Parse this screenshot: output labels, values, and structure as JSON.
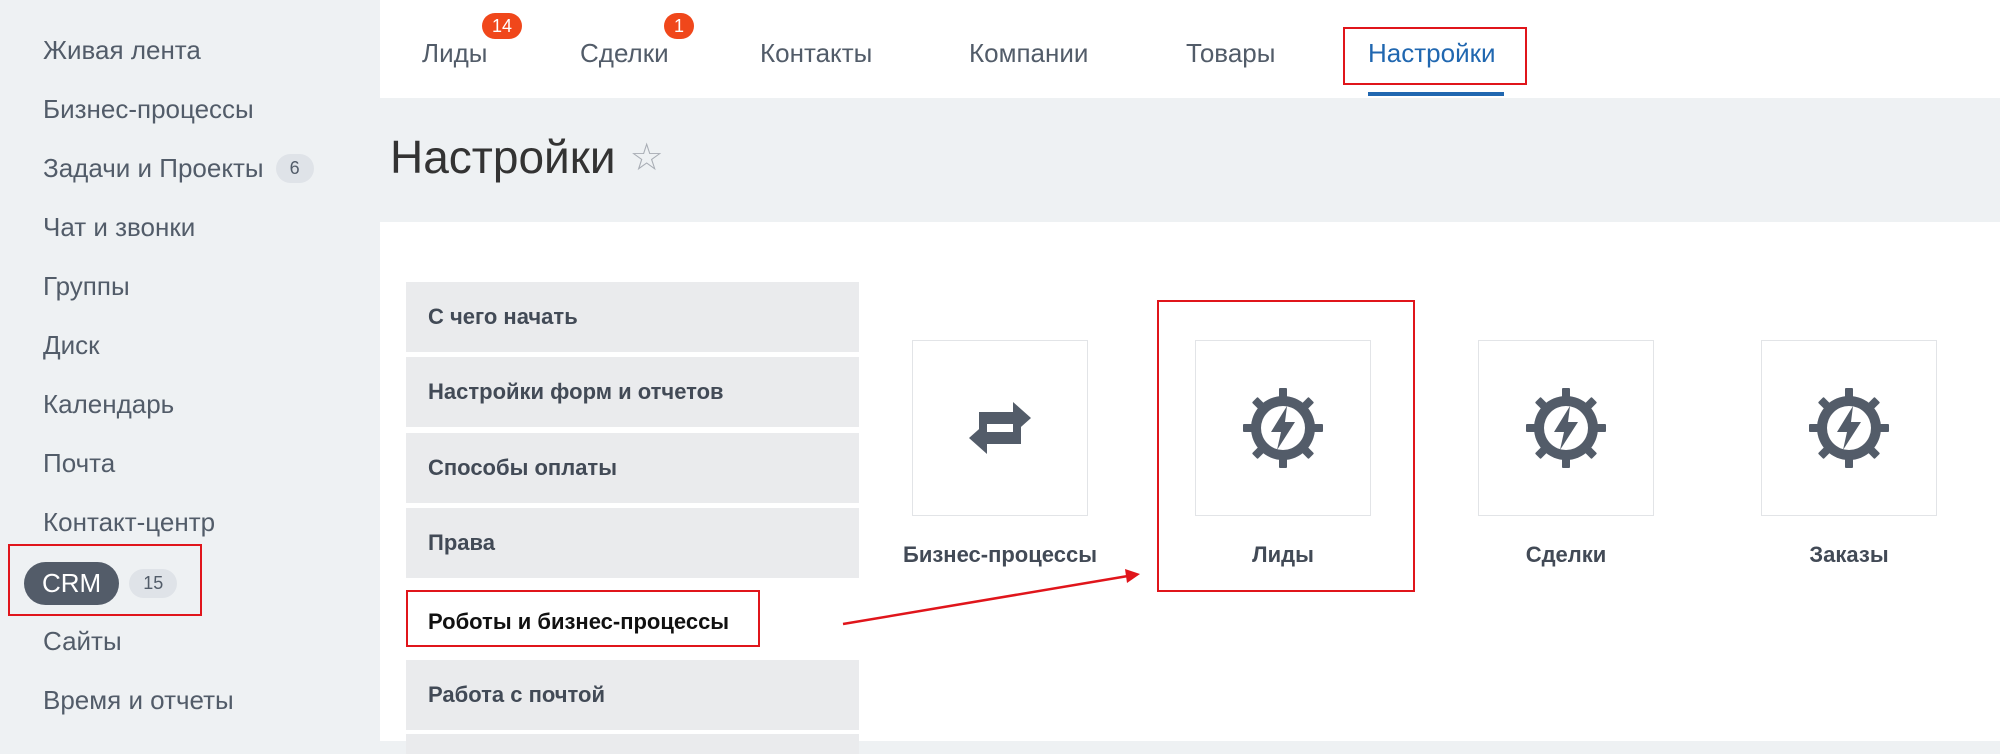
{
  "sidebar": {
    "items": [
      {
        "label": "Живая лента"
      },
      {
        "label": "Бизнес-процессы"
      },
      {
        "label": "Задачи и Проекты",
        "badge": "6"
      },
      {
        "label": "Чат и звонки"
      },
      {
        "label": "Группы"
      },
      {
        "label": "Диск"
      },
      {
        "label": "Календарь"
      },
      {
        "label": "Почта"
      },
      {
        "label": "Контакт-центр"
      },
      {
        "label": "CRM",
        "badge": "15"
      },
      {
        "label": "Сайты"
      },
      {
        "label": "Время и отчеты"
      }
    ]
  },
  "tabs": [
    {
      "label": "Лиды",
      "badge": "14"
    },
    {
      "label": "Сделки",
      "badge": "1"
    },
    {
      "label": "Контакты"
    },
    {
      "label": "Компании"
    },
    {
      "label": "Товары"
    },
    {
      "label": "Настройки",
      "active": true
    }
  ],
  "page": {
    "title": "Настройки"
  },
  "settings_menu": [
    {
      "label": "С чего начать"
    },
    {
      "label": "Настройки форм и отчетов"
    },
    {
      "label": "Способы оплаты"
    },
    {
      "label": "Права"
    },
    {
      "label": "Роботы и бизнес-процессы",
      "selected": true
    },
    {
      "label": "Работа с почтой"
    }
  ],
  "tiles": [
    {
      "label": "Бизнес-процессы",
      "icon": "refresh-icon"
    },
    {
      "label": "Лиды",
      "icon": "automation-gear-icon"
    },
    {
      "label": "Сделки",
      "icon": "automation-gear-icon"
    },
    {
      "label": "Заказы",
      "icon": "automation-gear-icon"
    }
  ],
  "colors": {
    "accent": "#2067b0",
    "badge": "#f0471b",
    "highlight": "#e0151b",
    "icon": "#535c69"
  }
}
